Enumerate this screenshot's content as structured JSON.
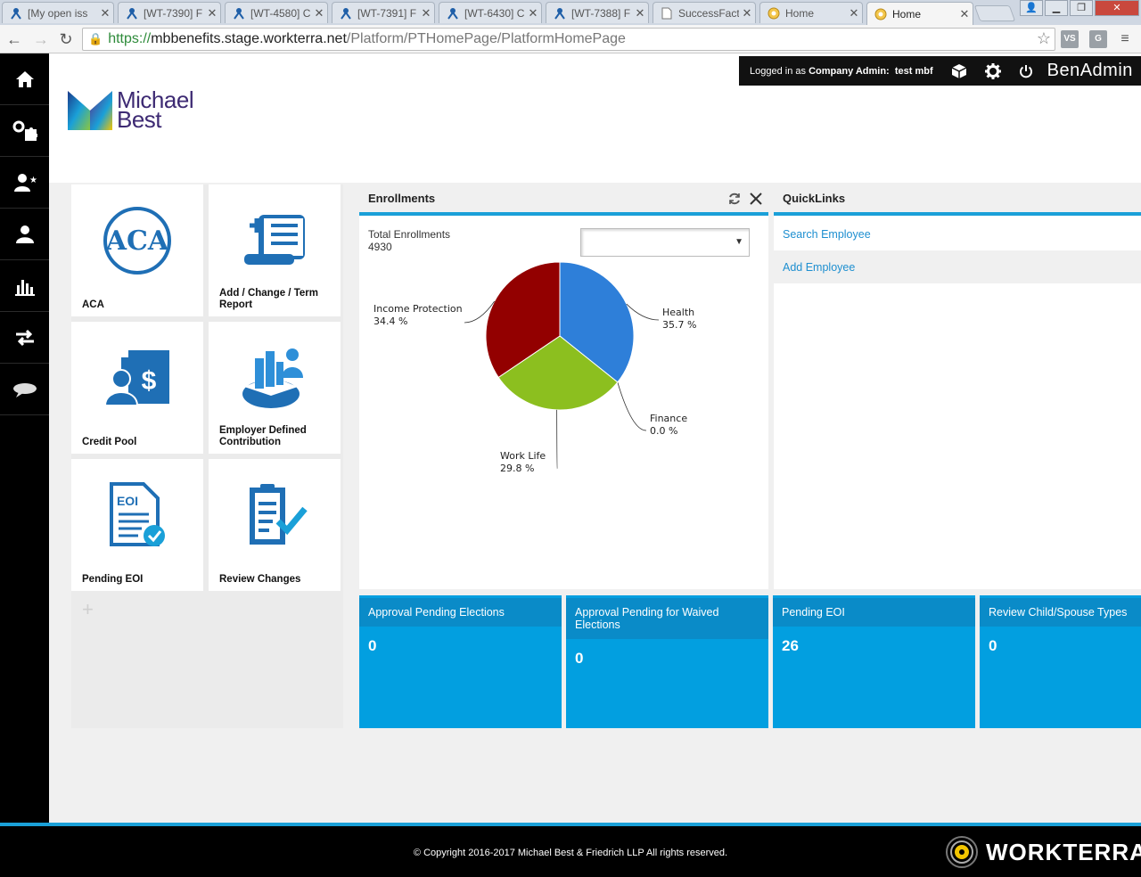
{
  "browser": {
    "tabs": [
      {
        "label": "[My open iss",
        "icon": "jira-icon"
      },
      {
        "label": "[WT-7390] F",
        "icon": "jira-icon"
      },
      {
        "label": "[WT-4580] C",
        "icon": "jira-icon"
      },
      {
        "label": "[WT-7391] F",
        "icon": "jira-icon"
      },
      {
        "label": "[WT-6430] C",
        "icon": "jira-icon"
      },
      {
        "label": "[WT-7388] F",
        "icon": "jira-icon"
      },
      {
        "label": "SuccessFact",
        "icon": "page-icon"
      },
      {
        "label": "Home",
        "icon": "globe-icon"
      },
      {
        "label": "Home",
        "icon": "globe-icon",
        "active": true
      }
    ],
    "url": {
      "scheme": "https://",
      "host": "mbbenefits.stage.workterra.net",
      "path": "/Platform/PTHomePage/PlatformHomePage"
    },
    "extensions": [
      "VS",
      "G"
    ]
  },
  "header": {
    "logged_in_prefix": "Logged in as ",
    "role": "Company Admin:",
    "user": "test mbf",
    "brand": "BenAdmin"
  },
  "logo": {
    "line1": "Michael",
    "line2": "Best"
  },
  "left_nav": [
    "home-icon",
    "puzzle-icon",
    "user-star-icon",
    "user-icon",
    "bar-chart-icon",
    "transfer-icon",
    "chat-icon"
  ],
  "tiles": [
    {
      "label": "ACA",
      "icon": "aca-icon"
    },
    {
      "label": "Add / Change / Term Report",
      "icon": "report-scroll-icon"
    },
    {
      "label": "Credit Pool",
      "icon": "credit-pool-icon"
    },
    {
      "label": "Employer Defined Contribution",
      "icon": "employer-contribution-icon"
    },
    {
      "label": "Pending EOI",
      "icon": "eoi-document-icon"
    },
    {
      "label": "Review Changes",
      "icon": "review-changes-icon"
    }
  ],
  "add_tile": "+",
  "enrollments": {
    "title": "Enrollments",
    "total_label": "Total Enrollments",
    "total_value": "4930",
    "select_value": ""
  },
  "chart_data": {
    "type": "pie",
    "title": "",
    "slices": [
      {
        "label": "Health",
        "value": 35.7,
        "value_label": "35.7 %",
        "color": "#2e7fd9"
      },
      {
        "label": "Finance",
        "value": 0.0,
        "value_label": "0.0 %",
        "color": "#1e5fb0"
      },
      {
        "label": "Work Life",
        "value": 29.8,
        "value_label": "29.8 %",
        "color": "#8cbf1f"
      },
      {
        "label": "Income Protection",
        "value": 34.4,
        "value_label": "34.4 %",
        "color": "#930000"
      }
    ]
  },
  "quicklinks": {
    "title": "QuickLinks",
    "items": [
      "Search Employee",
      "Add Employee"
    ]
  },
  "stats": [
    {
      "label": "Approval Pending Elections",
      "value": "0"
    },
    {
      "label": "Approval Pending for Waived Elections",
      "value": "0"
    },
    {
      "label": "Pending EOI",
      "value": "26"
    },
    {
      "label": "Review Child/Spouse Types",
      "value": "0"
    }
  ],
  "footer": {
    "copyright": "© Copyright 2016-2017 Michael Best & Friedrich LLP All rights reserved.",
    "brand": "WORKTERRA"
  },
  "colors": {
    "accent": "#1aa0d8",
    "stat_tile": "#029fe0",
    "stat_header": "#0a8bc8",
    "icon_blue": "#1f6fb5",
    "logo_purple": "#3d2a73"
  }
}
